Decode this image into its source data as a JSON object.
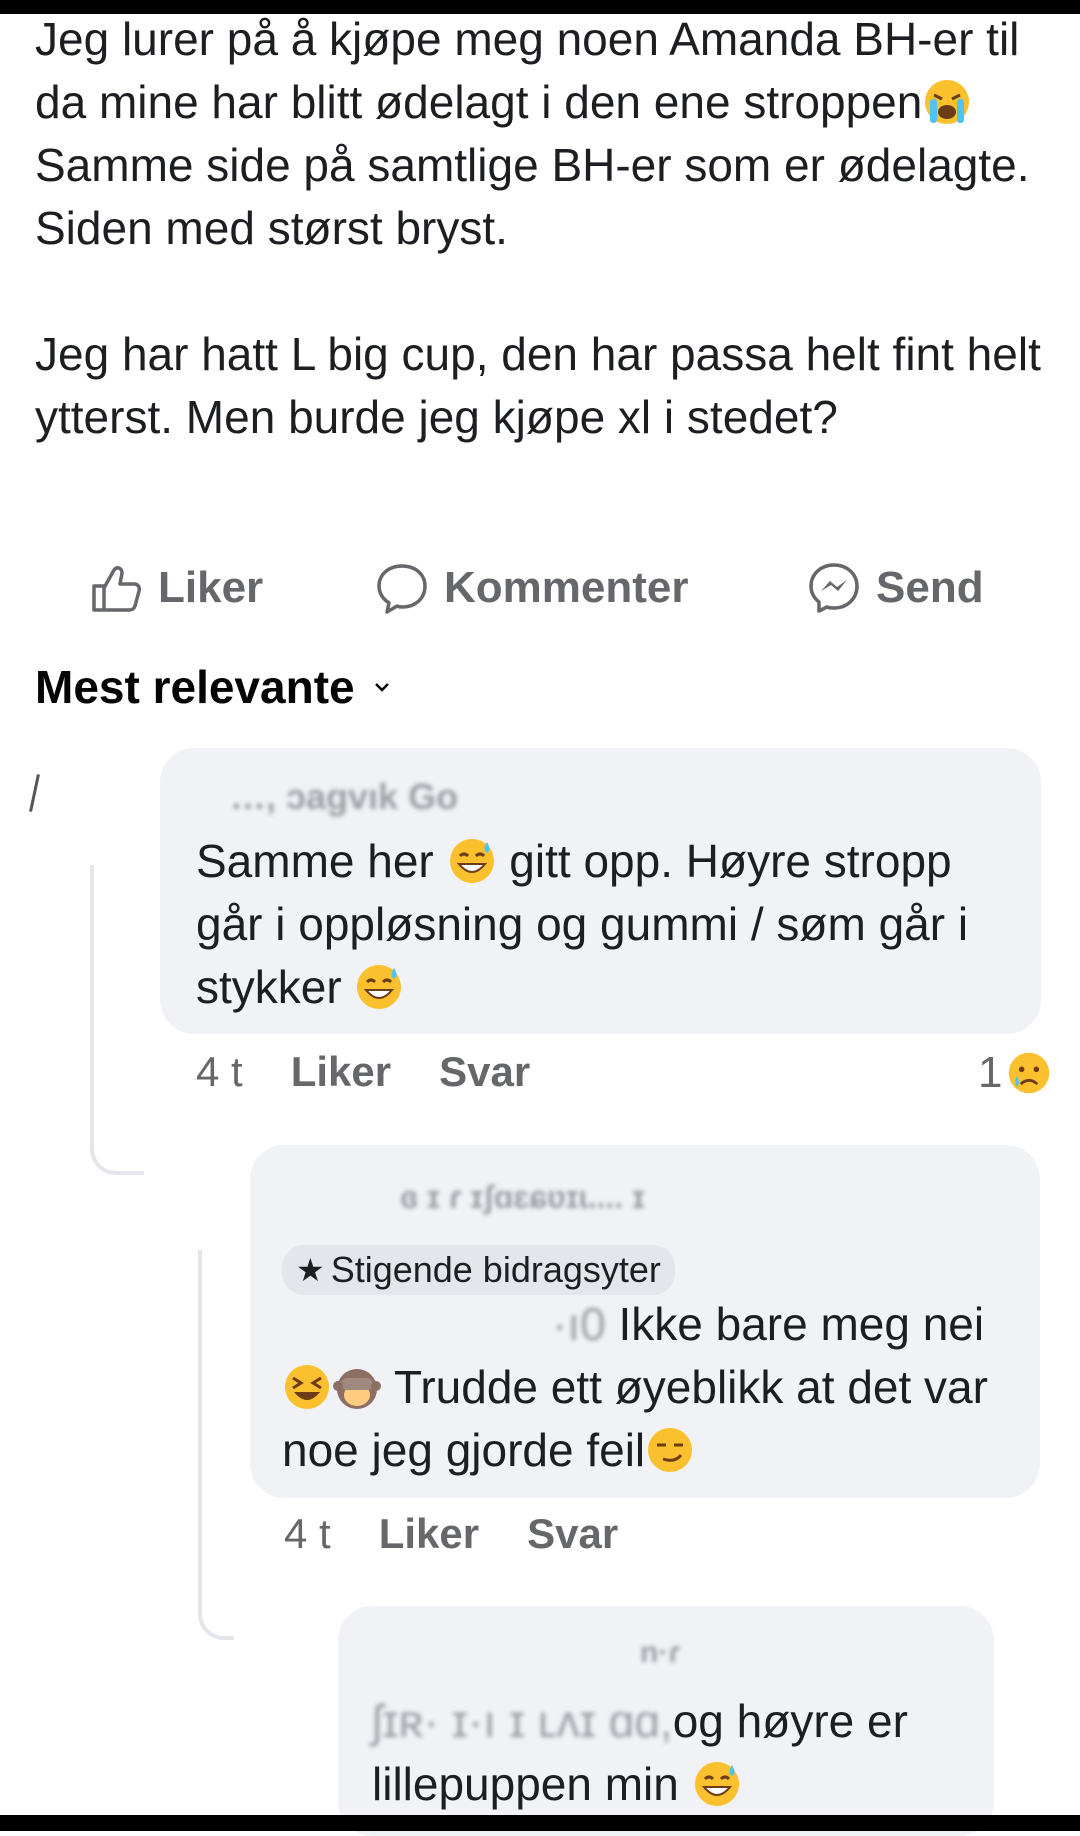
{
  "post": {
    "paragraph1_a": "Jeg lurer på å kjøpe meg noen Amanda BH-er til da mine har blitt ødelagt i den ene stroppen",
    "paragraph1_b": " Samme side på samtlige BH-er som er ødelagte. Siden med størst bryst.",
    "paragraph2": "Jeg har hatt L big cup, den har passa helt fint helt ytterst. Men burde jeg kjøpe xl i stedet?"
  },
  "actions": {
    "like": "Liker",
    "comment": "Kommenter",
    "send": "Send"
  },
  "sort": {
    "label": "Mest relevante"
  },
  "comments": [
    {
      "name": "…, ɔagvık Go",
      "text_a": "Samme her ",
      "text_b": " gitt opp.  Høyre stropp går i oppløsning og gummi / søm går i stykker ",
      "time": "4 t",
      "like": "Liker",
      "reply": "Svar",
      "reaction_count": "1"
    },
    {
      "name": "ɞ ɪ ɾ ɪʃɑɛɕʋɪɩ.... ɪ",
      "badge": "Stigende bidragsyter",
      "text_pre": "·ı0",
      "text_a": " Ikke bare meg nei",
      "text_c": " Trudde ett øyeblikk at det var noe jeg gjorde feil",
      "time": "4 t",
      "like": "Liker",
      "reply": "Svar"
    },
    {
      "name": "n·ɾ",
      "text_pre": "ʃɪʀ·  ɪ·ı ɪ ʟʌɪ ɑɑ,",
      "text_a": "og høyre er lillepuppen min "
    }
  ],
  "icons": {
    "like": "thumbs-up-icon",
    "comment": "speech-bubble-icon",
    "send": "messenger-icon",
    "sort": "chevron-down-icon"
  },
  "colors": {
    "bubble": "#f0f2f5",
    "muted": "#65676b",
    "text": "#1c1e21"
  }
}
